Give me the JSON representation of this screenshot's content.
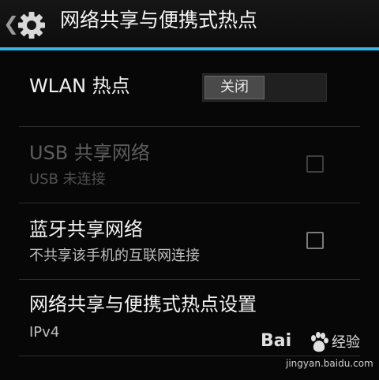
{
  "actionbar": {
    "up_glyph": "❮",
    "title": "网络共享与便携式热点",
    "accent_color": "#33b5e5",
    "icon": "gear-icon"
  },
  "wlan": {
    "title": "WLAN 热点",
    "switch_label": "关闭",
    "switch_state": "off"
  },
  "usb": {
    "title": "USB 共享网络",
    "summary": "USB 未连接",
    "checked": false,
    "enabled": false
  },
  "bluetooth": {
    "title": "蓝牙共享网络",
    "summary": "不共享该手机的互联网连接",
    "checked": false,
    "enabled": true
  },
  "settings": {
    "title": "网络共享与便携式热点设置",
    "summary": "IPv4"
  },
  "watermark": {
    "brand": "Bai",
    "brand2": "经验",
    "url": "jingyan.baidu.com"
  }
}
